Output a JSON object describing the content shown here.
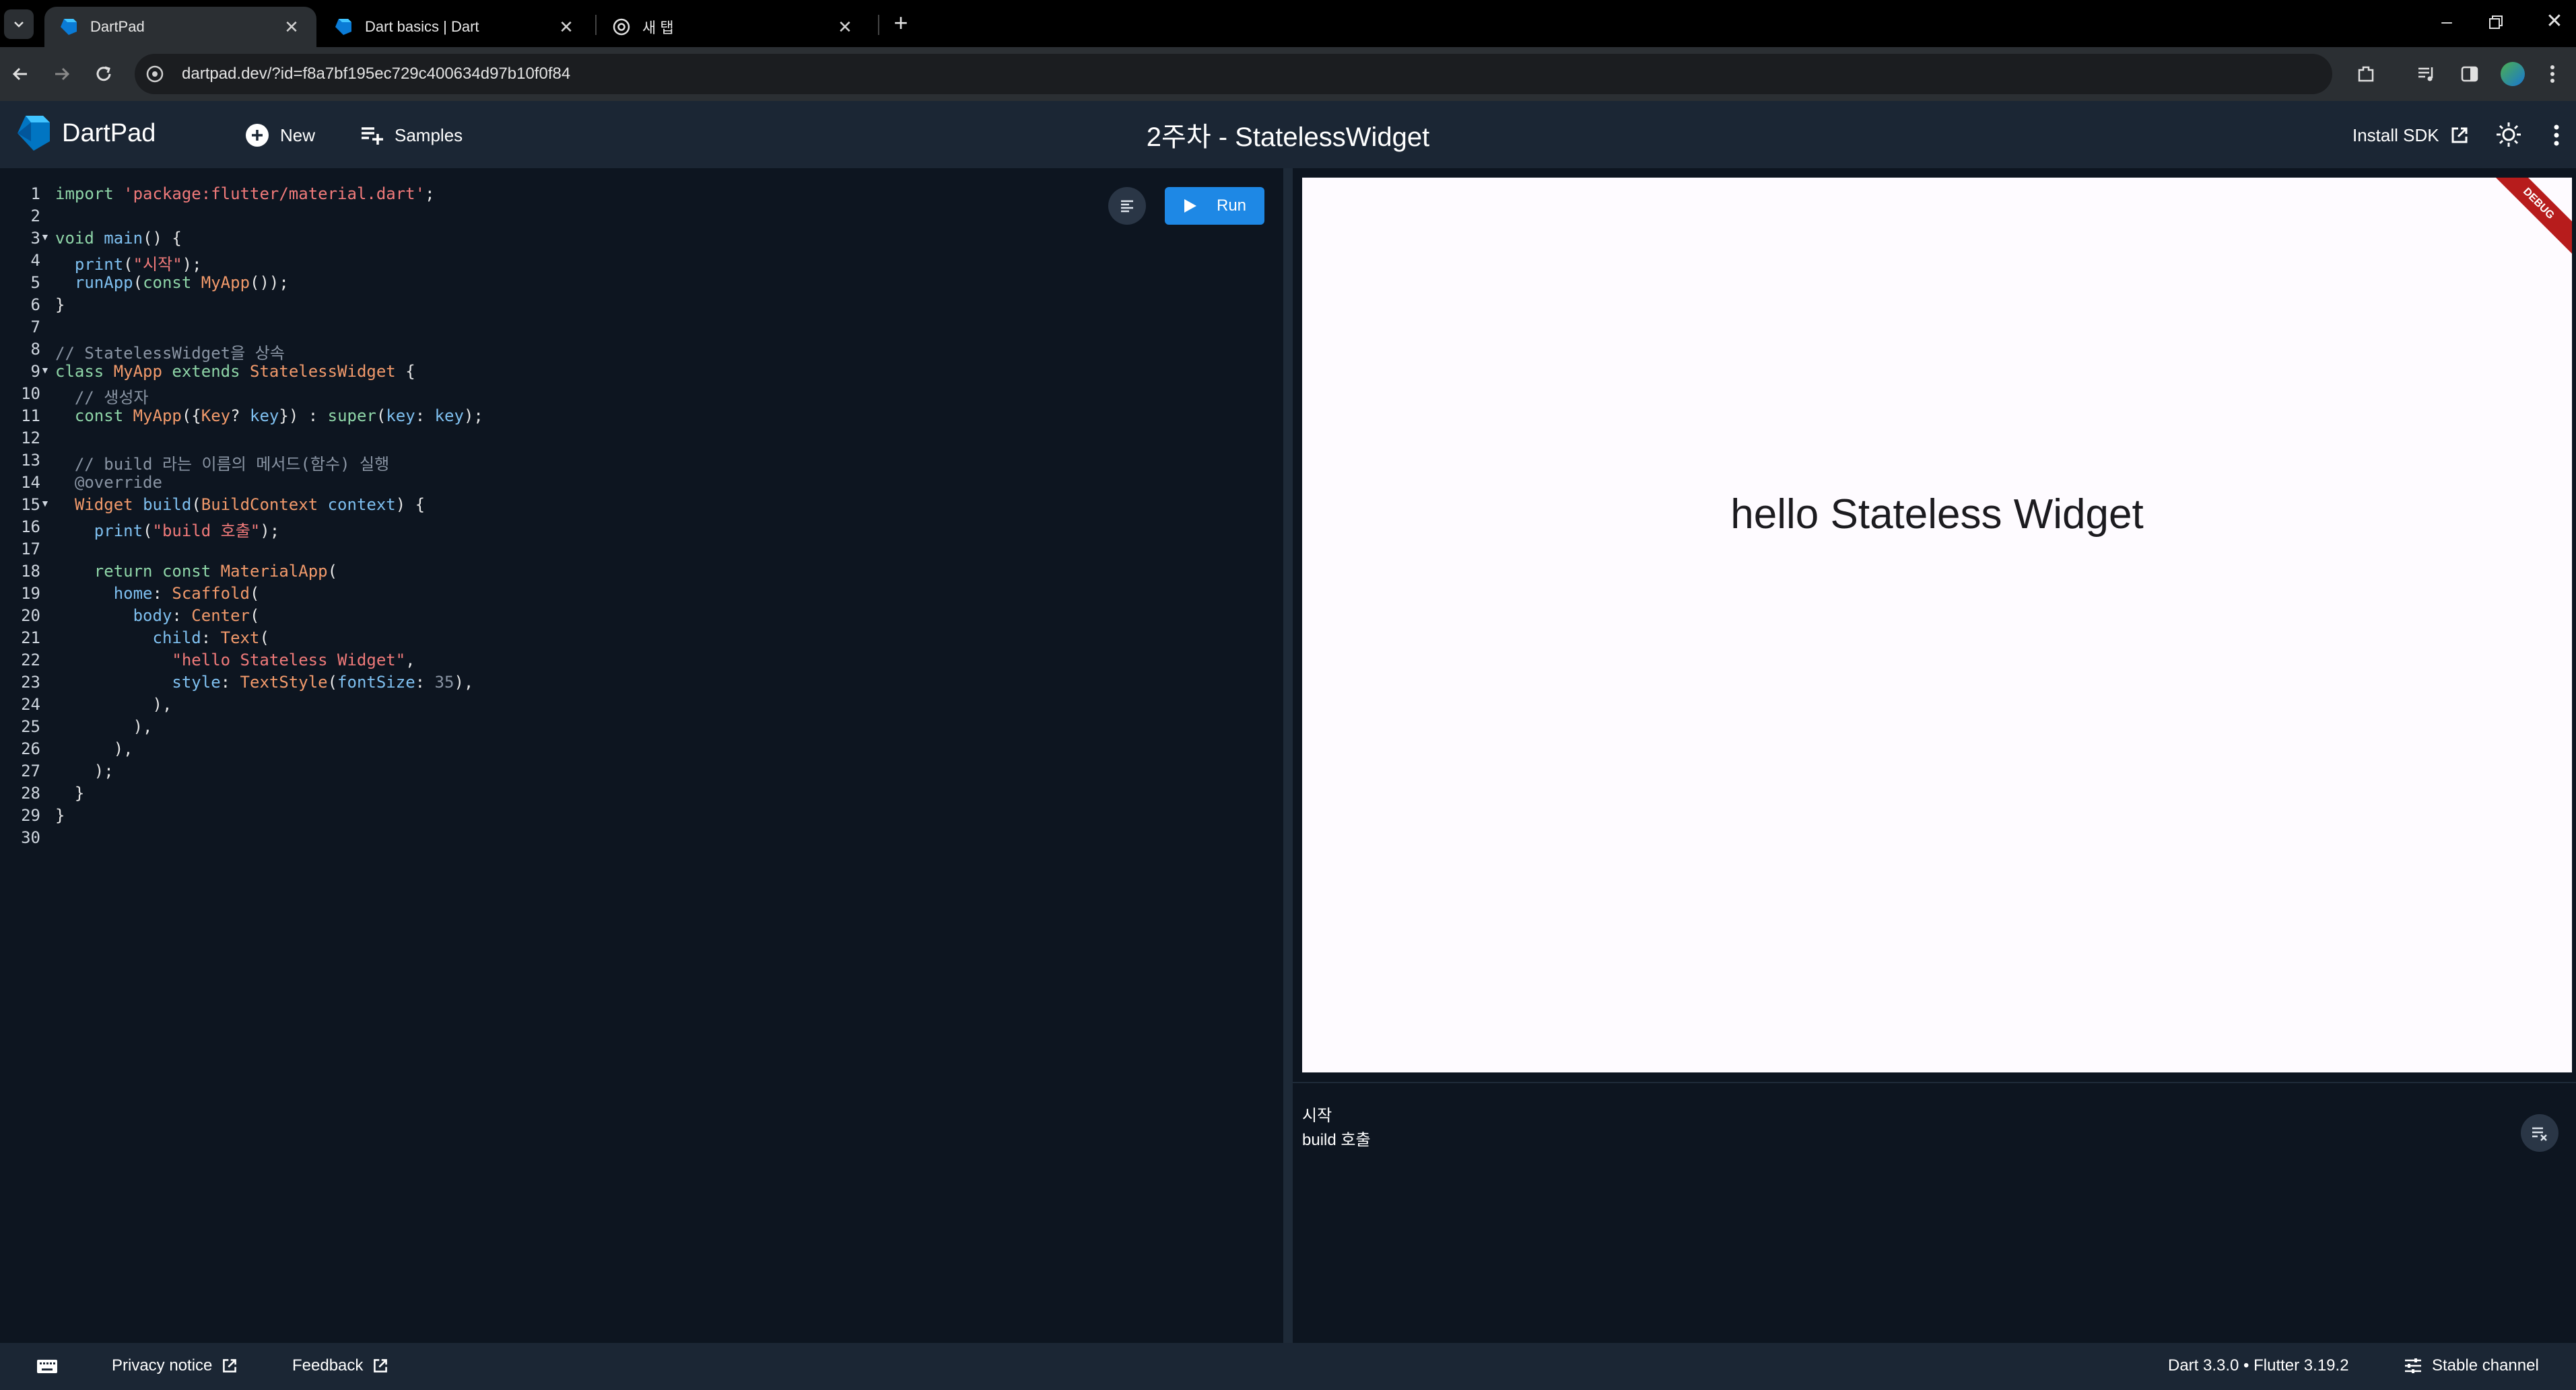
{
  "browser": {
    "tabs": [
      {
        "title": "DartPad",
        "active": true
      },
      {
        "title": "Dart basics | Dart",
        "active": false
      },
      {
        "title": "새 탭",
        "active": false
      }
    ],
    "url": "dartpad.dev/?id=f8a7bf195ec729c400634d97b10f0f84"
  },
  "header": {
    "logo_text": "DartPad",
    "new_label": "New",
    "samples_label": "Samples",
    "doc_title": "2주차 - StatelessWidget",
    "install_sdk_label": "Install SDK"
  },
  "editor": {
    "run_label": "Run",
    "line_numbers": [
      "1",
      "2",
      "3",
      "4",
      "5",
      "6",
      "7",
      "8",
      "9",
      "10",
      "11",
      "12",
      "13",
      "14",
      "15",
      "16",
      "17",
      "18",
      "19",
      "20",
      "21",
      "22",
      "23",
      "24",
      "25",
      "26",
      "27",
      "28",
      "29",
      "30"
    ],
    "lines": [
      "import 'package:flutter/material.dart';",
      "",
      "void main() {",
      "  print(\"시작\");",
      "  runApp(const MyApp());",
      "}",
      "",
      "// StatelessWidget을 상속",
      "class MyApp extends StatelessWidget {",
      "  // 생성자",
      "  const MyApp({Key? key}) : super(key: key);",
      "",
      "  // build 라는 이름의 메서드(함수) 실행",
      "  @override",
      "  Widget build(BuildContext context) {",
      "    print(\"build 호출\");",
      "",
      "    return const MaterialApp(",
      "      home: Scaffold(",
      "        body: Center(",
      "          child: Text(",
      "            \"hello Stateless Widget\",",
      "            style: TextStyle(fontSize: 35),",
      "          ),",
      "        ),",
      "      ),",
      "    );",
      "  }",
      "}",
      ""
    ]
  },
  "preview": {
    "text": "hello Stateless Widget",
    "debug_banner": "DEBUG"
  },
  "console": {
    "lines": [
      "시작",
      "build 호출"
    ]
  },
  "status": {
    "privacy_label": "Privacy notice",
    "feedback_label": "Feedback",
    "version_label": "Dart 3.3.0 • Flutter 3.19.2",
    "channel_label": "Stable channel"
  },
  "colors": {
    "accent": "#1e88e5",
    "editor_bg": "#0d1520",
    "header_bg": "#1b2634",
    "debug_red": "#b71c1c"
  }
}
